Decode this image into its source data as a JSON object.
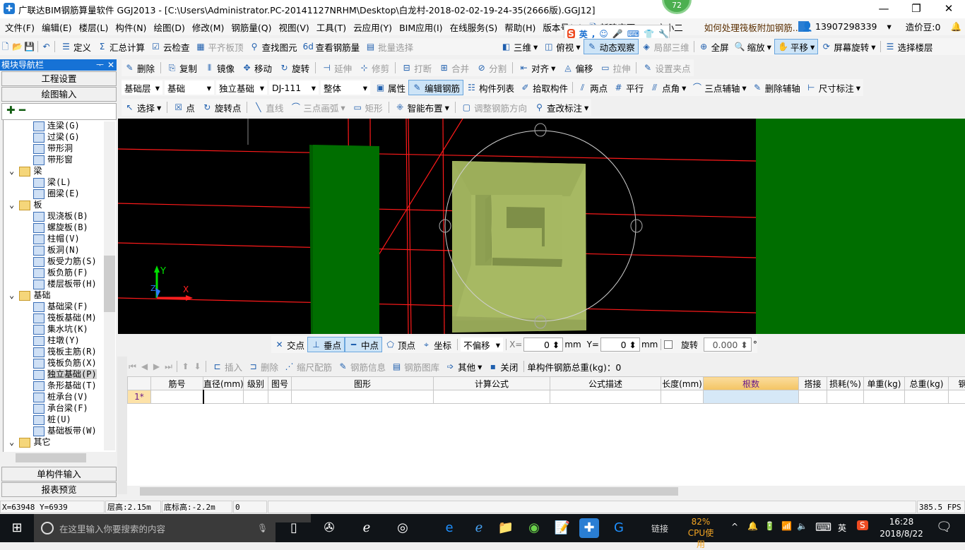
{
  "title": "广联达BIM钢筋算量软件 GGJ2013 - [C:\\Users\\Administrator.PC-20141127NRHM\\Desktop\\白龙村-2018-02-02-19-24-35(2666版).GGJ12]",
  "notification_badge": "72",
  "menu": [
    "文件(F)",
    "编辑(E)",
    "楼层(L)",
    "构件(N)",
    "绘图(D)",
    "修改(M)",
    "钢筋量(Q)",
    "视图(V)",
    "工具(T)",
    "云应用(Y)",
    "BIM应用(I)",
    "在线服务(S)",
    "帮助(H)",
    "版本号(B)"
  ],
  "menu_extra": {
    "new_change": "新建变更",
    "assistant": "广小二",
    "tip": "如何处理筏板附加钢筋..",
    "user": "13907298339",
    "beans": "造价豆:0"
  },
  "ime": {
    "lang": "英"
  },
  "toolbar1": [
    "定义",
    "汇总计算",
    "云检查",
    "平齐板顶",
    "查找图元",
    "查看钢筋量",
    "批量选择"
  ],
  "toolbar1_right": [
    "三维",
    "俯视",
    "动态观察",
    "局部三维",
    "全屏",
    "缩放",
    "平移",
    "屏幕旋转",
    "选择楼层"
  ],
  "toolbar2": [
    "删除",
    "复制",
    "镜像",
    "移动",
    "旋转",
    "延伸",
    "修剪",
    "打断",
    "合并",
    "分割",
    "对齐",
    "偏移",
    "拉伸",
    "设置夹点"
  ],
  "selectors": {
    "floor": "基础层",
    "type": "基础",
    "sub": "独立基础",
    "name": "DJ-111",
    "mode": "整体"
  },
  "toolbar3": [
    "属性",
    "编辑钢筋",
    "构件列表",
    "拾取构件",
    "两点",
    "平行",
    "点角",
    "三点辅轴",
    "删除辅轴",
    "尺寸标注"
  ],
  "toolbar4": [
    "选择",
    "点",
    "旋转点",
    "直线",
    "三点画弧",
    "矩形",
    "智能布置",
    "调整钢筋方向",
    "查改标注"
  ],
  "nav": {
    "title": "模块导航栏",
    "project_settings": "工程设置",
    "drawing_input": "绘图输入",
    "single_input": "单构件输入",
    "report_preview": "报表预览"
  },
  "tree": [
    {
      "label": "连梁(G)",
      "level": 2
    },
    {
      "label": "过梁(G)",
      "level": 2
    },
    {
      "label": "带形洞",
      "level": 2
    },
    {
      "label": "带形窗",
      "level": 2
    },
    {
      "label": "梁",
      "level": 1
    },
    {
      "label": "梁(L)",
      "level": 2
    },
    {
      "label": "圈梁(E)",
      "level": 2
    },
    {
      "label": "板",
      "level": 1
    },
    {
      "label": "现浇板(B)",
      "level": 2
    },
    {
      "label": "螺旋板(B)",
      "level": 2
    },
    {
      "label": "柱帽(V)",
      "level": 2
    },
    {
      "label": "板洞(N)",
      "level": 2
    },
    {
      "label": "板受力筋(S)",
      "level": 2
    },
    {
      "label": "板负筋(F)",
      "level": 2
    },
    {
      "label": "楼层板带(H)",
      "level": 2
    },
    {
      "label": "基础",
      "level": 1
    },
    {
      "label": "基础梁(F)",
      "level": 2
    },
    {
      "label": "筏板基础(M)",
      "level": 2
    },
    {
      "label": "集水坑(K)",
      "level": 2
    },
    {
      "label": "柱墩(Y)",
      "level": 2
    },
    {
      "label": "筏板主筋(R)",
      "level": 2
    },
    {
      "label": "筏板负筋(X)",
      "level": 2
    },
    {
      "label": "独立基础(P)",
      "level": 2,
      "selected": true
    },
    {
      "label": "条形基础(T)",
      "level": 2
    },
    {
      "label": "桩承台(V)",
      "level": 2
    },
    {
      "label": "承台梁(F)",
      "level": 2
    },
    {
      "label": "桩(U)",
      "level": 2
    },
    {
      "label": "基础板带(W)",
      "level": 2
    },
    {
      "label": "其它",
      "level": 1
    }
  ],
  "snap": {
    "items": [
      "交点",
      "垂点",
      "中点",
      "顶点",
      "坐标"
    ],
    "offset": "不偏移",
    "x_label": "X=",
    "x": "0",
    "unit": "mm",
    "y_label": "Y=",
    "y": "0",
    "rotate_label": "旋转",
    "rotate": "0.000",
    "deg": "°"
  },
  "rebar_toolbar": {
    "items": [
      "插入",
      "删除",
      "缩尺配筋",
      "钢筋信息",
      "钢筋图库",
      "其他",
      "关闭"
    ],
    "total": "单构件钢筋总重(kg)：0"
  },
  "table": {
    "columns": [
      "",
      "筋号",
      "直径(mm)",
      "级别",
      "图号",
      "图形",
      "计算公式",
      "公式描述",
      "长度(mm)",
      "根数",
      "搭接",
      "损耗(%)",
      "单重(kg)",
      "总重(kg)",
      "钢"
    ],
    "rows": [
      [
        "1*",
        "",
        "",
        "",
        "",
        "",
        "",
        "",
        "",
        "",
        "",
        "",
        "",
        "",
        ""
      ]
    ]
  },
  "statusbar": {
    "coords": "X=63948 Y=6939",
    "floor_height": "层高:2.15m",
    "bottom_elev": "底标高:-2.2m",
    "value": "0",
    "fps": "385.5 FPS"
  },
  "taskbar": {
    "search_placeholder": "在这里输入你要搜索的内容",
    "link": "链接",
    "cpu_pct": "82%",
    "cpu_label": "CPU使用",
    "lang": "英",
    "time": "16:28",
    "date": "2018/8/22"
  },
  "colors": {
    "canvas": "#000000",
    "wall": "#006e00",
    "foundation": "#a6b862",
    "axis": "#ff0000",
    "selection_blue": "#1672d6"
  }
}
